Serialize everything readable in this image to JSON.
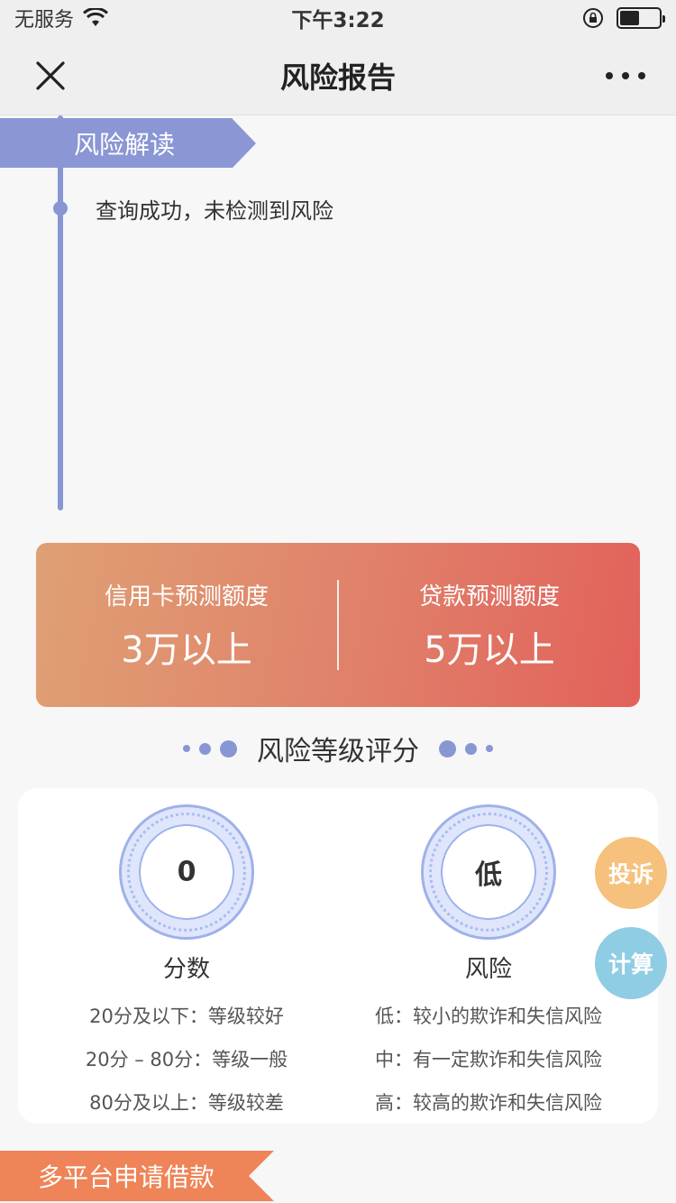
{
  "status_bar": {
    "carrier": "无服务",
    "time": "下午3:22",
    "battery_level": 0.5
  },
  "nav": {
    "title": "风险报告"
  },
  "risk_section": {
    "title": "风险解读",
    "message": "查询成功，未检测到风险"
  },
  "quota": {
    "credit_card_label": "信用卡预测额度",
    "credit_card_value": "3万以上",
    "loan_label": "贷款预测额度",
    "loan_value": "5万以上"
  },
  "score_section": {
    "title": "风险等级评分",
    "score": {
      "value": "0",
      "caption": "分数",
      "legend": [
        "20分及以下：等级较好",
        "20分 – 80分：等级一般",
        "80分及以上：等级较差"
      ]
    },
    "risk": {
      "value": "低",
      "caption": "风险",
      "legend": [
        "低：较小的欺诈和失信风险",
        "中：有一定欺诈和失信风险",
        "高：较高的欺诈和失信风险"
      ]
    }
  },
  "fab": {
    "complaint": "投诉",
    "calculate": "计算"
  },
  "bottom_section": {
    "title": "多平台申请借款"
  },
  "colors": {
    "accent": "#8a97d4",
    "card_gradient_start": "#dfa074",
    "card_gradient_end": "#e2615a",
    "complaint_button": "#f6c17c",
    "calculate_button": "#8fcde4",
    "bottom_ribbon": "#ee8457"
  }
}
